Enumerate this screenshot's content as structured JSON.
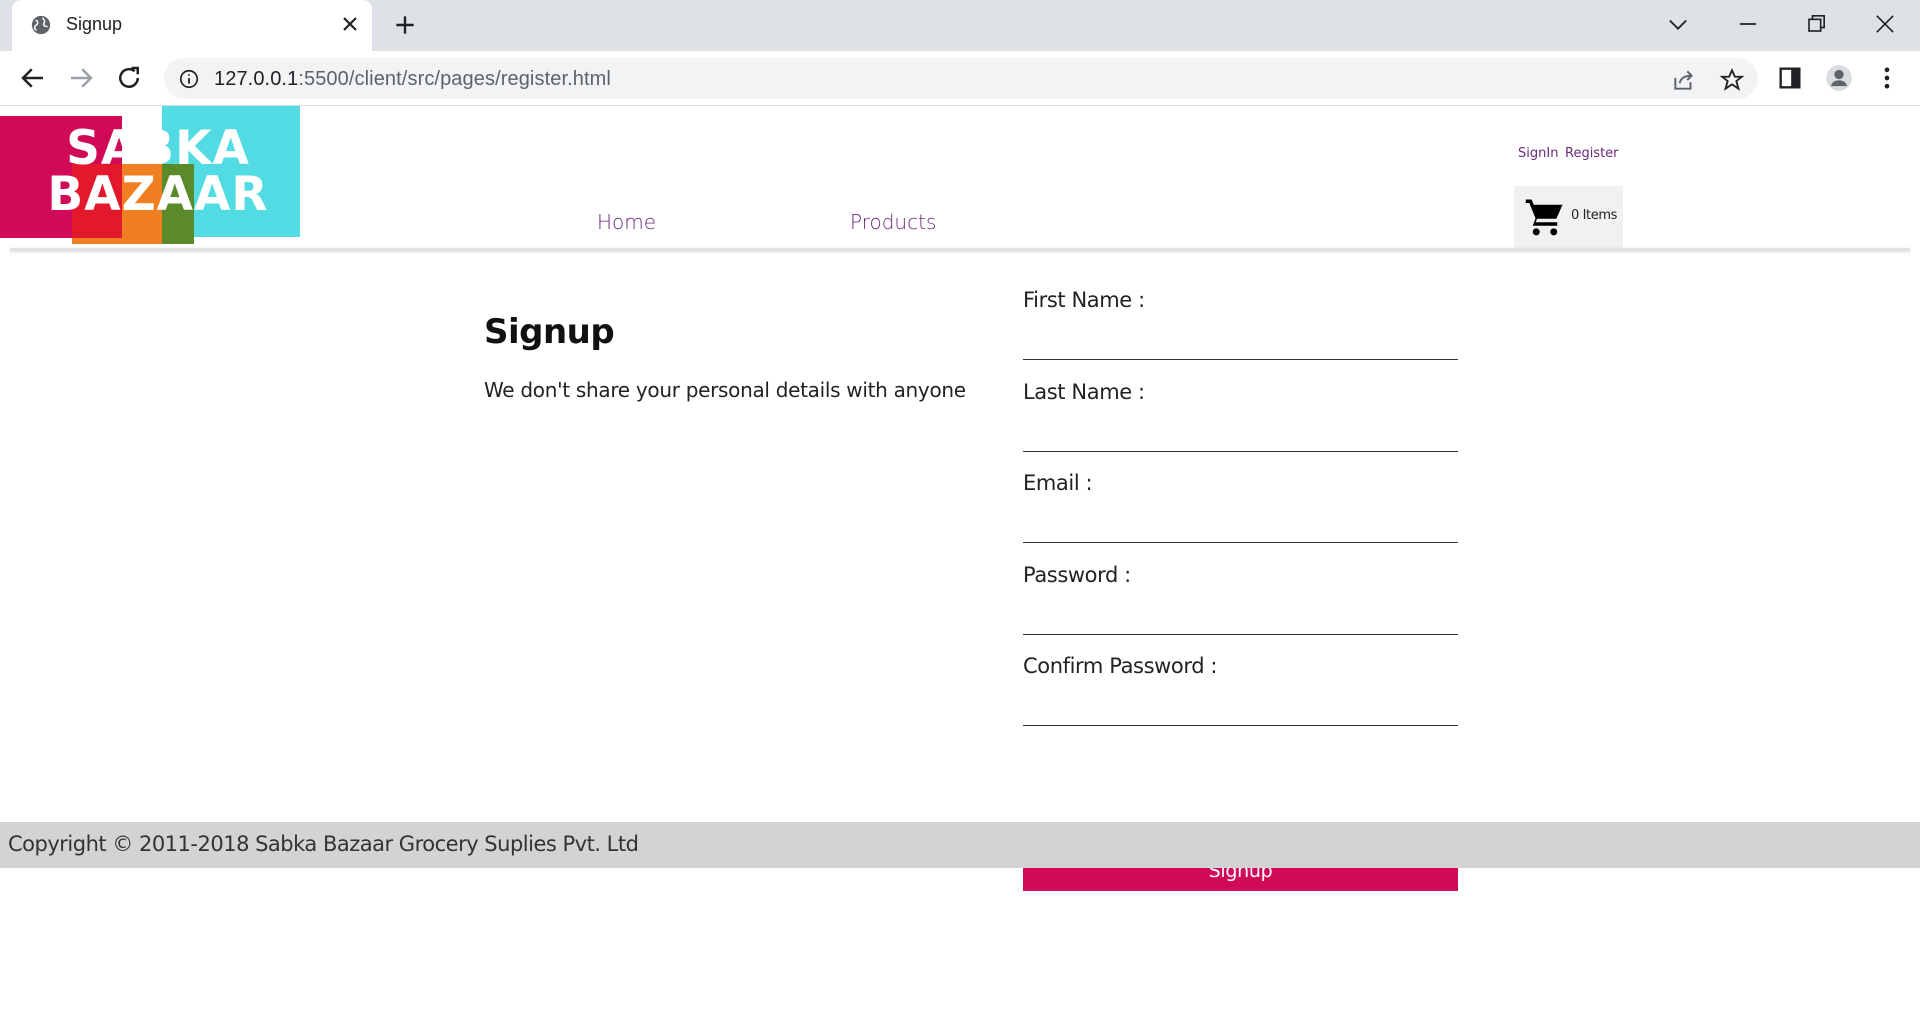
{
  "browser": {
    "tab_title": "Signup",
    "url_host": "127.0.0.1",
    "url_rest": ":5500/client/src/pages/register.html"
  },
  "site": {
    "logo_line1": "SABKA",
    "logo_line2": "BAZAAR",
    "nav": [
      "Home",
      "Products"
    ],
    "auth": {
      "signin": "SignIn",
      "register": "Register"
    },
    "cart_label": "0 Items"
  },
  "signup": {
    "title": "Signup",
    "subtitle": "We don't share your personal details with anyone",
    "fields": [
      {
        "label": "First Name :",
        "value": ""
      },
      {
        "label": "Last Name :",
        "value": ""
      },
      {
        "label": "Email :",
        "value": ""
      },
      {
        "label": "Password :",
        "value": ""
      },
      {
        "label": "Confirm Password :",
        "value": ""
      }
    ],
    "submit_label": "Signup"
  },
  "footer": {
    "copyright": "Copyright © 2011-2018 Sabka Bazaar Grocery Suplies Pvt. Ltd"
  },
  "colors": {
    "brand_pink": "#d10a57",
    "nav_purple": "#6b2a7a",
    "footer_bg": "#d3d3d3"
  },
  "icons": [
    "globe-icon",
    "close-icon",
    "plus-icon",
    "back-icon",
    "forward-icon",
    "reload-icon",
    "info-icon",
    "share-icon",
    "star-icon",
    "sidepanel-icon",
    "profile-icon",
    "menu-icon",
    "chevron-down-icon",
    "minimize-icon",
    "restore-icon",
    "window-close-icon",
    "cart-icon"
  ]
}
